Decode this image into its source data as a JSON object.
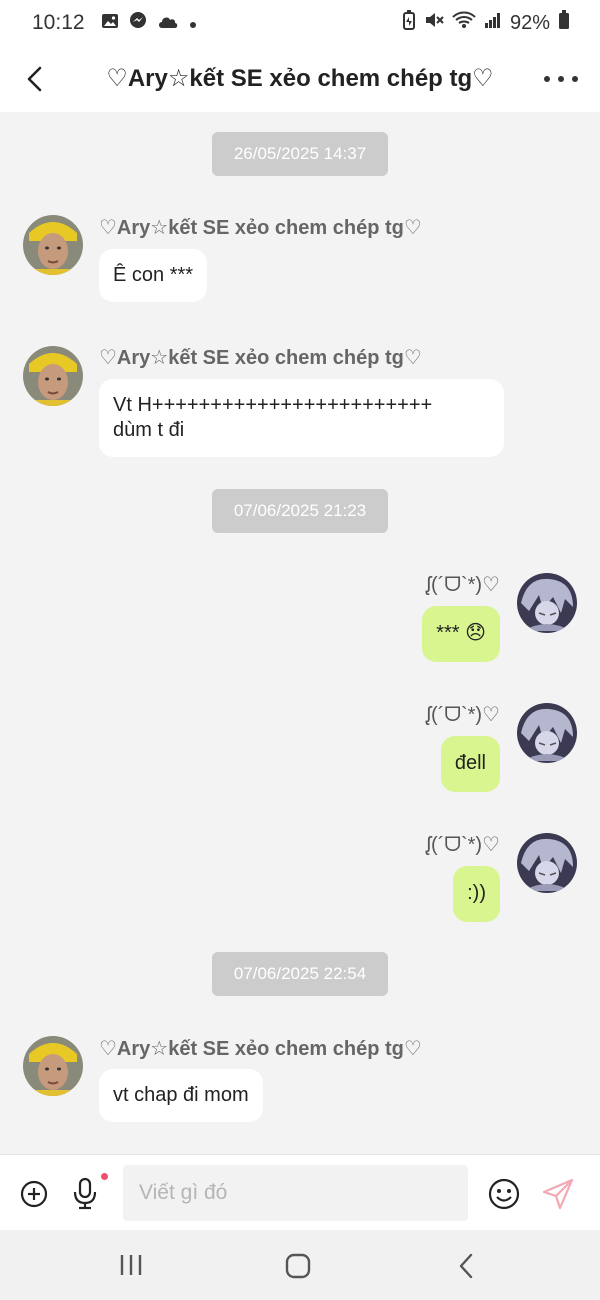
{
  "status_bar": {
    "time": "10:12",
    "battery": "92%",
    "icons": [
      "gallery-icon",
      "messenger-icon",
      "cloud-icon",
      "dot-icon",
      "battery-saver-icon",
      "mute-icon",
      "wifi-icon",
      "signal-icon",
      "battery-icon"
    ]
  },
  "header": {
    "title": "♡Ary☆kết SE xẻo chem chép tg♡",
    "back_icon": "chevron-left-icon",
    "more_icon": "more-icon"
  },
  "chat": {
    "timestamps": [
      "26/05/2025 14:37",
      "07/06/2025 21:23",
      "07/06/2025 22:54"
    ],
    "incoming_sender": "♡Ary☆kết SE xẻo chem chép tg♡",
    "outgoing_sender": "ᶘ(´ᗜ`*)♡",
    "messages": [
      {
        "direction": "in",
        "text": "Ê con ***"
      },
      {
        "direction": "in",
        "line1": "Vt H++++++++++++++++++++++++",
        "line2": "dùm t đi"
      },
      {
        "direction": "out",
        "text": "***",
        "emoji": "😞"
      },
      {
        "direction": "out",
        "text": "đell"
      },
      {
        "direction": "out",
        "text": ":))"
      },
      {
        "direction": "in",
        "text": "vt chap đi mom"
      }
    ]
  },
  "input_bar": {
    "placeholder": "Viết gì đó",
    "value": "",
    "icons": [
      "plus-circle-icon",
      "microphone-icon",
      "emoji-icon",
      "send-icon"
    ]
  },
  "nav_bar": {
    "icons": [
      "recents-icon",
      "home-icon",
      "back-icon"
    ]
  },
  "colors": {
    "background": "#f3f3f3",
    "incoming_bubble": "#ffffff",
    "outgoing_bubble": "#d9f58f",
    "timestamp_bg": "#cccccc",
    "mic_dot": "#f0506e",
    "send_icon": "#f4a8b4"
  }
}
